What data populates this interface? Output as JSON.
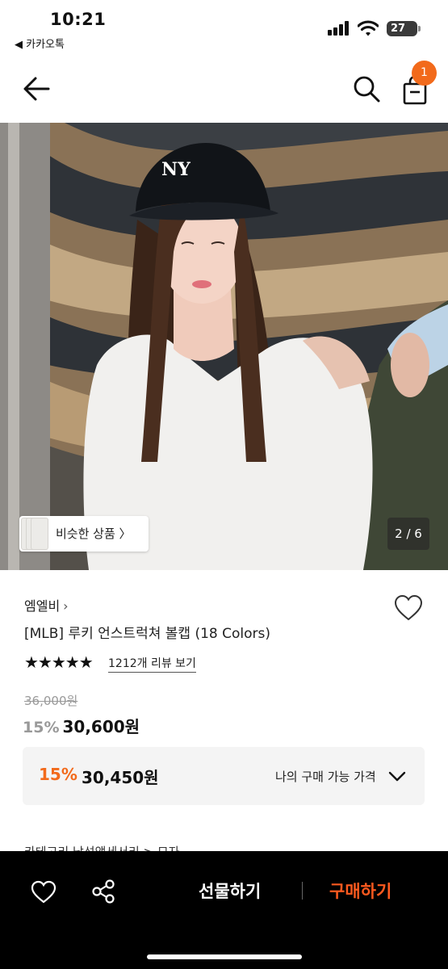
{
  "status_bar": {
    "time": "10:21",
    "back_app": "◀ 카카오톡",
    "battery": "27"
  },
  "header": {
    "back_icon": "arrow-left-icon",
    "search_icon": "search-icon",
    "bag_icon": "shopping-bag-icon",
    "cart_count": "1"
  },
  "gallery": {
    "similar_label": "비슷한 상품 〉",
    "page_indicator": "2 / 6"
  },
  "product": {
    "brand": "엠엘비",
    "brand_chevron": "›",
    "name": "[MLB] 루키 언스트럭쳐 볼캡 (18 Colors)",
    "stars": "★★★★★",
    "rating": 5,
    "review_link": "1212개 리뷰 보기",
    "original_price": "36,000원",
    "discount": "15%",
    "sale_price": "30,600원"
  },
  "my_price": {
    "discount": "15%",
    "price": "30,450원",
    "label": "나의 구매 가능 가격"
  },
  "category_peek": "카테고리 남성액세서리 > 모자",
  "bottom_bar": {
    "gift_label": "선물하기",
    "buy_label": "구매하기"
  },
  "colors": {
    "accent": "#f26a1b",
    "buy": "#ff5a1f",
    "bottom_bar": "#000000"
  }
}
